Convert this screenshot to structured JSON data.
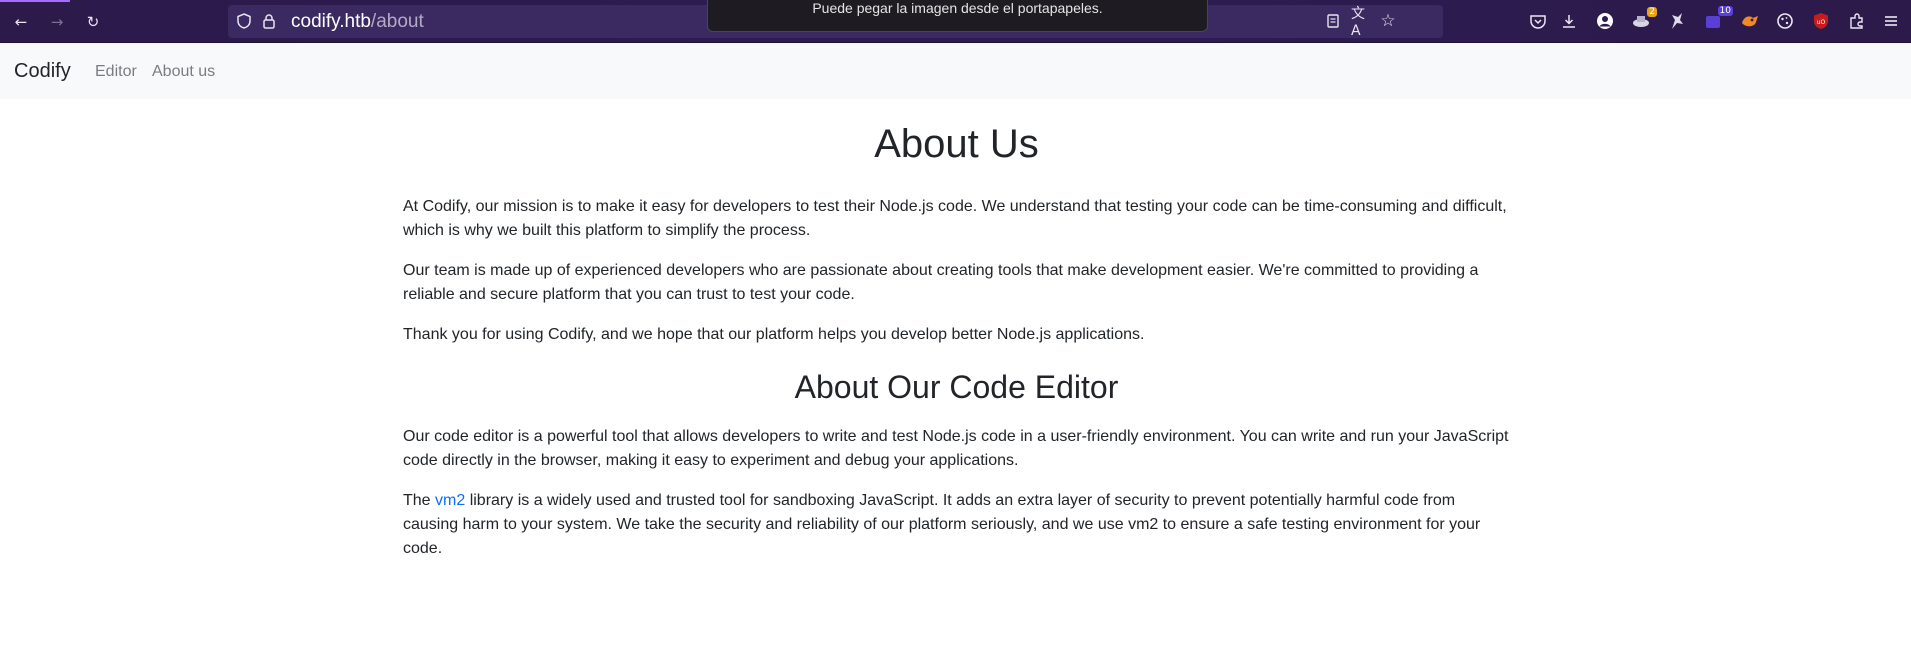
{
  "browser": {
    "url_host": "codify.htb",
    "url_path": "/about",
    "toast": "Puede pegar la imagen desde el portapapeles.",
    "icons": {
      "back": "back-arrow-icon",
      "forward": "forward-arrow-icon",
      "reload": "reload-icon",
      "shield": "shield-icon",
      "lock": "lock-icon",
      "reader": "reader-view-icon",
      "translate": "translate-icon",
      "bookmark": "star-icon"
    },
    "extensions": [
      {
        "name": "pocket-icon",
        "badge": ""
      },
      {
        "name": "download-icon",
        "badge": ""
      },
      {
        "name": "account-icon",
        "badge": ""
      },
      {
        "name": "extension-a-icon",
        "badge": "2"
      },
      {
        "name": "extension-b-icon",
        "badge": ""
      },
      {
        "name": "extension-c-icon",
        "badge": "10"
      },
      {
        "name": "extension-d-icon",
        "badge": ""
      },
      {
        "name": "cookie-icon",
        "badge": ""
      },
      {
        "name": "ublock-icon",
        "badge": ""
      },
      {
        "name": "puzzle-icon",
        "badge": ""
      },
      {
        "name": "menu-icon",
        "badge": ""
      }
    ]
  },
  "navbar": {
    "brand": "Codify",
    "links": [
      "Editor",
      "About us"
    ]
  },
  "about": {
    "heading": "About Us",
    "p1": "At Codify, our mission is to make it easy for developers to test their Node.js code. We understand that testing your code can be time-consuming and difficult, which is why we built this platform to simplify the process.",
    "p2": "Our team is made up of experienced developers who are passionate about creating tools that make development easier. We're committed to providing a reliable and secure platform that you can trust to test your code.",
    "p3": "Thank you for using Codify, and we hope that our platform helps you develop better Node.js applications."
  },
  "editor": {
    "heading": "About Our Code Editor",
    "p1": "Our code editor is a powerful tool that allows developers to write and test Node.js code in a user-friendly environment. You can write and run your JavaScript code directly in the browser, making it easy to experiment and debug your applications.",
    "p2_before": "The ",
    "p2_link": "vm2",
    "p2_after": " library is a widely used and trusted tool for sandboxing JavaScript. It adds an extra layer of security to prevent potentially harmful code from causing harm to your system. We take the security and reliability of our platform seriously, and we use vm2 to ensure a safe testing environment for your code."
  },
  "colors": {
    "toolbar": "#2b1a4a",
    "urlbar": "#3b2a62",
    "navbar": "#f8f9fa",
    "link": "#0d6efd",
    "text": "#212529",
    "nav_link": "#7a7d80"
  }
}
